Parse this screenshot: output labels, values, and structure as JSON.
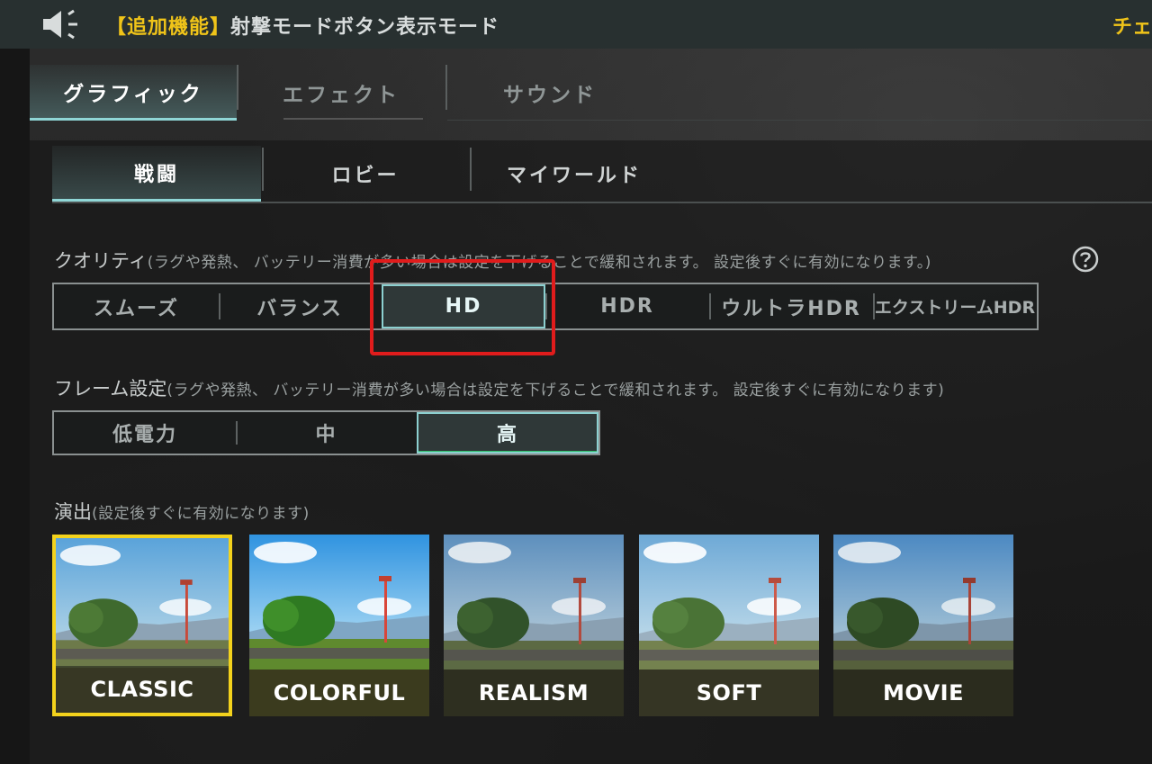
{
  "notice": {
    "tag": "【追加機能】",
    "text": "射撃モードボタン表示モード",
    "right_text": "チェ"
  },
  "main_tabs": [
    {
      "label": "グラフィック",
      "active": true
    },
    {
      "label": "エフェクト",
      "active": false
    },
    {
      "label": "サウンド",
      "active": false
    }
  ],
  "sub_tabs": [
    {
      "label": "戦闘",
      "active": true
    },
    {
      "label": "ロビー",
      "active": false
    },
    {
      "label": "マイワールド",
      "active": false
    }
  ],
  "quality": {
    "title": "クオリティ",
    "note": "(ラグや発熱、 バッテリー消費が多い場合は設定を下げることで緩和されます。 設定後すぐに有効になります。)",
    "help_icon": "question-circle-icon",
    "options": [
      "スムーズ",
      "バランス",
      "HD",
      "HDR",
      "ウルトラHDR",
      "エクストリームHDR"
    ],
    "selected": "HD"
  },
  "frame": {
    "title": "フレーム設定",
    "note": "(ラグや発熱、 バッテリー消費が多い場合は設定を下げることで緩和されます。 設定後すぐに有効になります)",
    "options": [
      "低電力",
      "中",
      "高"
    ],
    "selected": "高"
  },
  "style": {
    "title": "演出",
    "note": "(設定後すぐに有効になります)",
    "options": [
      "CLASSIC",
      "COLORFUL",
      "REALISM",
      "SOFT",
      "MOVIE"
    ],
    "selected": "CLASSIC"
  },
  "colors": {
    "accent_teal": "#8cd0d0",
    "highlight_red": "#e01c1c",
    "selected_yellow": "#f3d21c",
    "notice_yellow": "#f0c419"
  }
}
